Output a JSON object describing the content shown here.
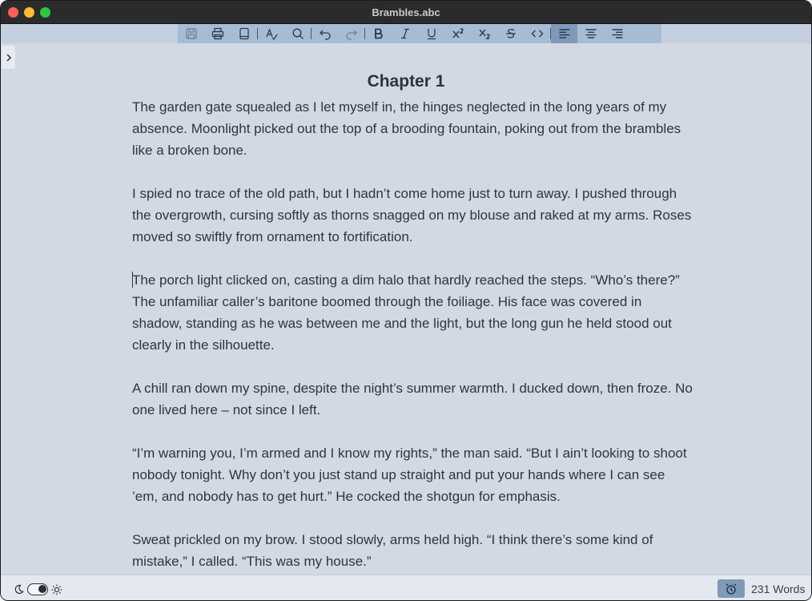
{
  "window": {
    "title": "Brambles.abc"
  },
  "toolbar": {
    "buttons": [
      {
        "name": "save-icon",
        "label": "Save",
        "enabled": false
      },
      {
        "name": "print-icon",
        "label": "Print",
        "enabled": true
      },
      {
        "name": "book-icon",
        "label": "Book",
        "enabled": true
      },
      {
        "name": "spellcheck-icon",
        "label": "Spelling",
        "enabled": true
      },
      {
        "name": "search-icon",
        "label": "Find",
        "enabled": true
      },
      {
        "name": "undo-icon",
        "label": "Undo",
        "enabled": true
      },
      {
        "name": "redo-icon",
        "label": "Redo",
        "enabled": false
      },
      {
        "name": "bold-icon",
        "label": "Bold",
        "enabled": true
      },
      {
        "name": "italic-icon",
        "label": "Italic",
        "enabled": true
      },
      {
        "name": "underline-icon",
        "label": "Underline",
        "enabled": true
      },
      {
        "name": "superscript-icon",
        "label": "Superscript",
        "enabled": true
      },
      {
        "name": "subscript-icon",
        "label": "Subscript",
        "enabled": true
      },
      {
        "name": "strikethrough-icon",
        "label": "Strikethrough",
        "enabled": true
      },
      {
        "name": "code-icon",
        "label": "Code",
        "enabled": true
      },
      {
        "name": "align-left-icon",
        "label": "Align left",
        "active": true
      },
      {
        "name": "align-center-icon",
        "label": "Align center",
        "active": false
      },
      {
        "name": "align-right-icon",
        "label": "Align right",
        "active": false
      }
    ]
  },
  "document": {
    "chapter_title": "Chapter 1",
    "paragraphs": [
      "The garden gate squealed as I let myself in, the hinges neglected in the long years of my absence. Moonlight picked out the top of a brooding fountain, poking out from the brambles like a broken bone.",
      "I spied no trace of the old path, but I hadn’t come home just to turn away. I pushed through the overgrowth, cursing softly as thorns snagged on my blouse and raked at my arms. Roses moved so swiftly from ornament to fortification.",
      "The porch light clicked on, casting a dim halo that hardly reached the steps. “Who’s there?” The unfamiliar caller’s baritone boomed through the foiliage. His face was covered in shadow, standing as he was between me and the light, but the long gun he held stood out clearly in the silhouette.",
      "A chill ran down my spine, despite the night’s summer warmth. I ducked down, then froze. No one lived here – not since I left.",
      "“I’m warning you, I’m armed and I know my rights,” the man said.  “But I ain’t looking to shoot nobody tonight. Why don’t you just stand up straight and put your hands where I can see ’em, and nobody has to get hurt.” He cocked the shotgun for emphasis.",
      "Sweat prickled on my brow. I stood slowly, arms held high. “I think there’s some kind of mistake,” I called. “This was my house.”"
    ]
  },
  "statusbar": {
    "theme_mode": "dark",
    "word_count": "231 Words"
  },
  "colors": {
    "page_background": "#d2d9e5",
    "toolbar_background": "#a6bcd5",
    "toolbar_active": "#7f9ab9",
    "titlebar": "#2b2b2d",
    "text": "#2f353c"
  }
}
